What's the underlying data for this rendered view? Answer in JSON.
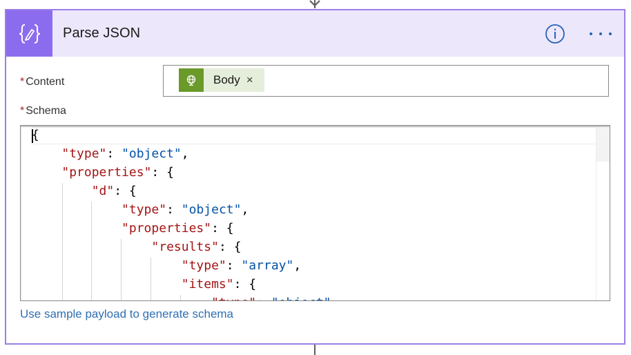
{
  "action": {
    "title": "Parse JSON",
    "icon": "curly-braces-icon",
    "accent": "#8c6cee",
    "header_bg": "#ece7fb"
  },
  "fields": {
    "content": {
      "required_marker": "*",
      "label": "Content",
      "token": {
        "label": "Body",
        "icon": "globe-icon",
        "remove": "×",
        "color": "#6a9a2a"
      }
    },
    "schema": {
      "required_marker": "*",
      "label": "Schema",
      "lines": [
        [
          {
            "t": "p",
            "s": "{"
          }
        ],
        [
          {
            "t": "p",
            "s": "    "
          },
          {
            "t": "k",
            "s": "\"type\""
          },
          {
            "t": "p",
            "s": ": "
          },
          {
            "t": "v",
            "s": "\"object\""
          },
          {
            "t": "p",
            "s": ","
          }
        ],
        [
          {
            "t": "p",
            "s": "    "
          },
          {
            "t": "k",
            "s": "\"properties\""
          },
          {
            "t": "p",
            "s": ": {"
          }
        ],
        [
          {
            "t": "p",
            "s": "        "
          },
          {
            "t": "k",
            "s": "\"d\""
          },
          {
            "t": "p",
            "s": ": {"
          }
        ],
        [
          {
            "t": "p",
            "s": "            "
          },
          {
            "t": "k",
            "s": "\"type\""
          },
          {
            "t": "p",
            "s": ": "
          },
          {
            "t": "v",
            "s": "\"object\""
          },
          {
            "t": "p",
            "s": ","
          }
        ],
        [
          {
            "t": "p",
            "s": "            "
          },
          {
            "t": "k",
            "s": "\"properties\""
          },
          {
            "t": "p",
            "s": ": {"
          }
        ],
        [
          {
            "t": "p",
            "s": "                "
          },
          {
            "t": "k",
            "s": "\"results\""
          },
          {
            "t": "p",
            "s": ": {"
          }
        ],
        [
          {
            "t": "p",
            "s": "                    "
          },
          {
            "t": "k",
            "s": "\"type\""
          },
          {
            "t": "p",
            "s": ": "
          },
          {
            "t": "v",
            "s": "\"array\""
          },
          {
            "t": "p",
            "s": ","
          }
        ],
        [
          {
            "t": "p",
            "s": "                    "
          },
          {
            "t": "k",
            "s": "\"items\""
          },
          {
            "t": "p",
            "s": ": {"
          }
        ],
        [
          {
            "t": "p",
            "s": "                        "
          },
          {
            "t": "k",
            "s": "\"type\""
          },
          {
            "t": "p",
            "s": ": "
          },
          {
            "t": "v",
            "s": "\"object\""
          },
          {
            "t": "p",
            "s": ","
          }
        ]
      ]
    }
  },
  "sample_payload_link": "Use sample payload to generate schema",
  "header_buttons": {
    "info": "info-icon",
    "more": "more-options-icon"
  }
}
